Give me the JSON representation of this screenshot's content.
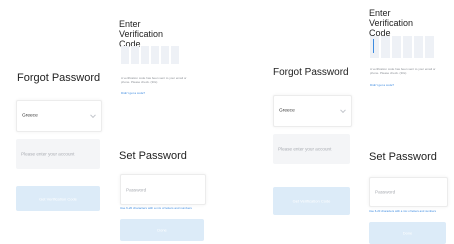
{
  "screens": [
    {
      "forgot": {
        "title": "Forgot Password",
        "region": "Greece",
        "account_placeholder": "Please enter your account",
        "submit_label": "Get Verification Code"
      },
      "verify": {
        "title": "Enter Verification Code",
        "hint": "A verification code has been sent to your email or phone. Please check. (30s)",
        "resend_link": "Didn't get a code?"
      },
      "set_password": {
        "title": "Set Password",
        "password_placeholder": "Password",
        "password_hint": "Use 6-20 characters with a mix of letters and numbers",
        "confirm_label": "Done"
      }
    },
    {
      "forgot": {
        "title": "Forgot Password",
        "region": "Greece",
        "account_placeholder": "Please enter your account",
        "submit_label": "Get Verification Code"
      },
      "verify": {
        "title": "Enter Verification Code",
        "hint": "A verification code has been sent to your email or phone. Please check. (30s)",
        "resend_link": "Didn't get a code?"
      },
      "set_password": {
        "title": "Set Password",
        "password_placeholder": "Password",
        "password_hint": "Use 6-20 characters with a mix of letters and numbers",
        "confirm_label": "Done"
      }
    }
  ],
  "colors": {
    "accent": "#3d8be0",
    "button_disabled": "#dcebf8",
    "field_bg": "#f4f5f7"
  },
  "icons": [
    "chevron-down-icon"
  ]
}
